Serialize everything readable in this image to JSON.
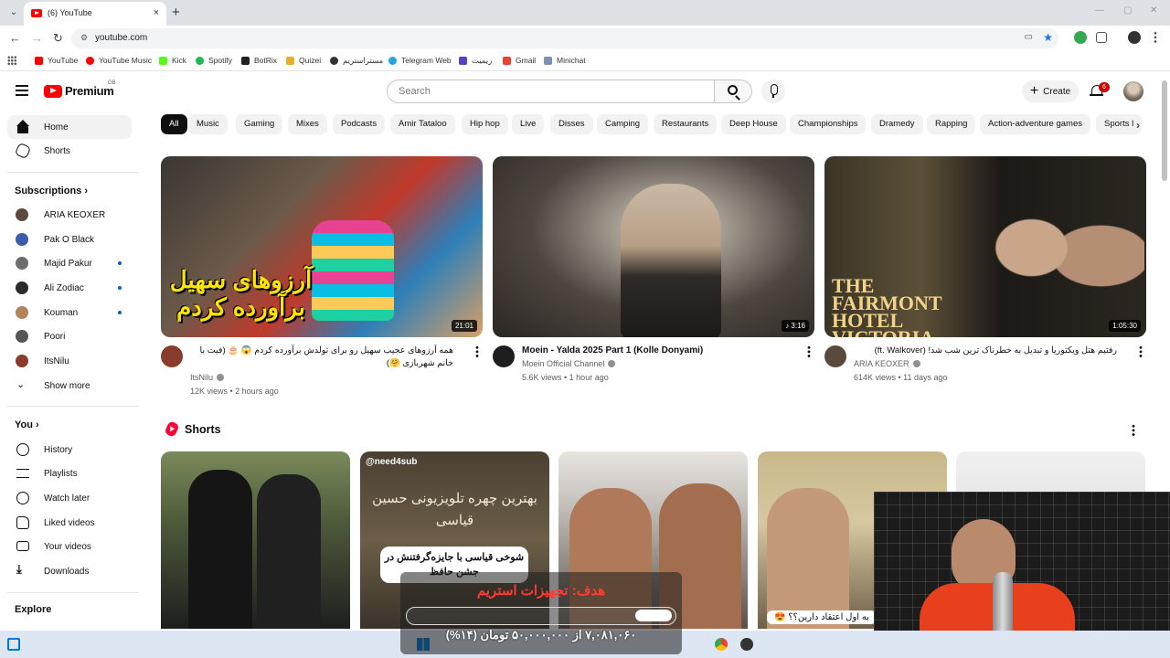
{
  "browser": {
    "tab_title": "(6) YouTube",
    "new_tab": "+",
    "close": "×",
    "url": "youtube.com",
    "bookmarks": [
      "YouTube",
      "YouTube Music",
      "Kick",
      "Spotify",
      "BotRix",
      "Quizei",
      "مستراستریم",
      "Telegram Web",
      "ریمیت",
      "Gmail",
      "Minichat"
    ]
  },
  "header": {
    "brand": "Premium",
    "country": "GB",
    "search_placeholder": "Search",
    "create_label": "Create",
    "notification_count": "6"
  },
  "sidebar": {
    "main": [
      {
        "label": "Home",
        "icon": "home-icon"
      },
      {
        "label": "Shorts",
        "icon": "shorts-icon"
      }
    ],
    "subscriptions_title": "Subscriptions",
    "subscriptions": [
      {
        "label": "ARIA KEOXER",
        "color": "#5a4a3e",
        "new": false
      },
      {
        "label": "Pak O Black",
        "color": "#3b5bab",
        "new": false
      },
      {
        "label": "Majid Pakur",
        "color": "#6d6d6d",
        "new": true
      },
      {
        "label": "Ali Zodiac",
        "color": "#2a2a2a",
        "new": true
      },
      {
        "label": "Kouman",
        "color": "#b5835a",
        "new": true
      },
      {
        "label": "Poori",
        "color": "#555555",
        "new": false
      },
      {
        "label": "ItsNilu",
        "color": "#8a3c2c",
        "new": false
      }
    ],
    "show_more": "Show more",
    "you_title": "You",
    "you": [
      {
        "label": "History",
        "icon": "history-icon"
      },
      {
        "label": "Playlists",
        "icon": "playlists-icon"
      },
      {
        "label": "Watch later",
        "icon": "watch-later-icon"
      },
      {
        "label": "Liked videos",
        "icon": "like-icon"
      },
      {
        "label": "Your videos",
        "icon": "your-videos-icon"
      },
      {
        "label": "Downloads",
        "icon": "download-icon"
      }
    ],
    "explore_title": "Explore"
  },
  "chips": [
    "All",
    "Music",
    "Gaming",
    "Mixes",
    "Podcasts",
    "Amir Tataloo",
    "Hip hop",
    "Live",
    "Disses",
    "Camping",
    "Restaurants",
    "Deep House",
    "Championships",
    "Dramedy",
    "Rapping",
    "Action-adventure games",
    "Sports l"
  ],
  "videos": [
    {
      "title": "همه آرزوهای عجیب سهیل رو برای تولدش برآورده کردم 😱 🎂 (فیت با خانم شهربازی 🤗)",
      "channel": "ItsNilu",
      "meta": "12K views • 2 hours ago",
      "duration": "21:01",
      "thumb_text": "آرزوهای سهیل برآورده کردم",
      "rtl": true
    },
    {
      "title": "Moein - Yalda 2025 Part 1 (Kolle Donyami)",
      "channel": "Moein Official Channel",
      "meta": "5.6K views • 1 hour ago",
      "duration": "3:16",
      "thumb_text": "",
      "rtl": false
    },
    {
      "title": "رفتیم هتل ویکتوریا و تبدیل به خطرناک ترین شب شد! (ft. Walkover)",
      "channel": "ARIA KEOXER",
      "meta": "614K views • 11 days ago",
      "duration": "1:05:30",
      "thumb_text": "THE FAIRMONT HOTEL VICTORIA",
      "rtl": true
    }
  ],
  "shorts": {
    "title": "Shorts",
    "items": [
      {
        "overlay": ""
      },
      {
        "overlay": "@need4sub",
        "caption": "شوخی قیاسی با جایزه‌گرفتنش در جشن حافظ",
        "big_text": "بهترین چهره تلویزیونی حسین قیاسی"
      },
      {
        "overlay": ""
      },
      {
        "overlay": "",
        "caption": "به اول اعتقاد دارین؟؟ 😍"
      },
      {
        "overlay": ""
      }
    ]
  },
  "stream_overlay": {
    "goal_text": "هدف: تجهیزات استریم",
    "progress_text": "۷,۰۸۱,۰۶۰ از ۵۰,۰۰۰,۰۰۰ تومان (۱۴%)",
    "progress_fraction": 0.14
  }
}
